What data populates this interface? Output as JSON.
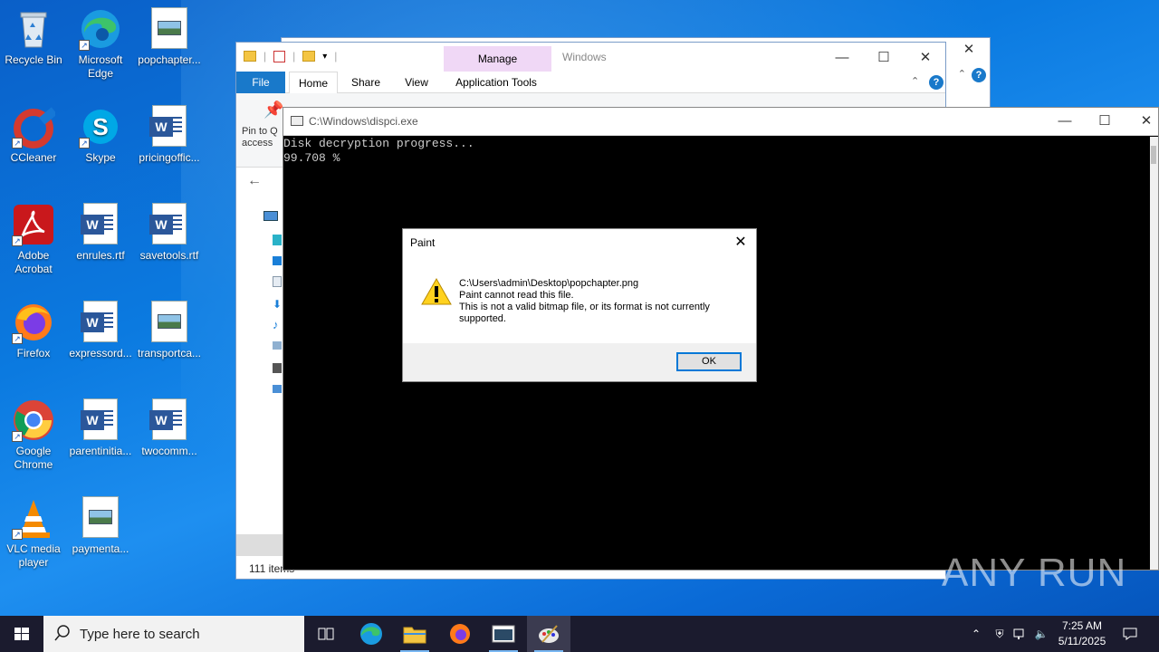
{
  "desktop": {
    "icons": [
      {
        "label": "Recycle Bin"
      },
      {
        "label": "Microsoft Edge"
      },
      {
        "label": "popchapter..."
      },
      {
        "label": "CCleaner"
      },
      {
        "label": "Skype"
      },
      {
        "label": "pricingoffic..."
      },
      {
        "label": "Adobe Acrobat"
      },
      {
        "label": "enrules.rtf"
      },
      {
        "label": "savetools.rtf"
      },
      {
        "label": "Firefox"
      },
      {
        "label": "expressord..."
      },
      {
        "label": "transportca..."
      },
      {
        "label": "Google Chrome"
      },
      {
        "label": "parentinitia..."
      },
      {
        "label": "twocomm..."
      },
      {
        "label": "VLC media player"
      },
      {
        "label": "paymenta..."
      }
    ]
  },
  "explorer": {
    "context_tab": "Manage",
    "title": "Windows",
    "tabs": [
      "File",
      "Home",
      "Share",
      "View",
      "Application Tools"
    ],
    "pin_label": "Pin to Q\naccess",
    "status_items": "111 items"
  },
  "console": {
    "title": "C:\\Windows\\dispci.exe",
    "line1": "Disk decryption progress...",
    "line2": "99.708 %"
  },
  "dialog": {
    "title": "Paint",
    "path": "C:\\Users\\admin\\Desktop\\popchapter.png",
    "msg1": "Paint cannot read this file.",
    "msg2": "This is not a valid bitmap file, or its format is not currently supported.",
    "ok_label": "OK"
  },
  "watermark": "ANY RUN",
  "taskbar": {
    "search_placeholder": "Type here to search",
    "time": "7:25 AM",
    "date": "5/11/2025"
  },
  "colors": {
    "accent": "#1979ca",
    "manage_tab": "#f0d8f6",
    "taskbar": "#1b1b2e"
  }
}
